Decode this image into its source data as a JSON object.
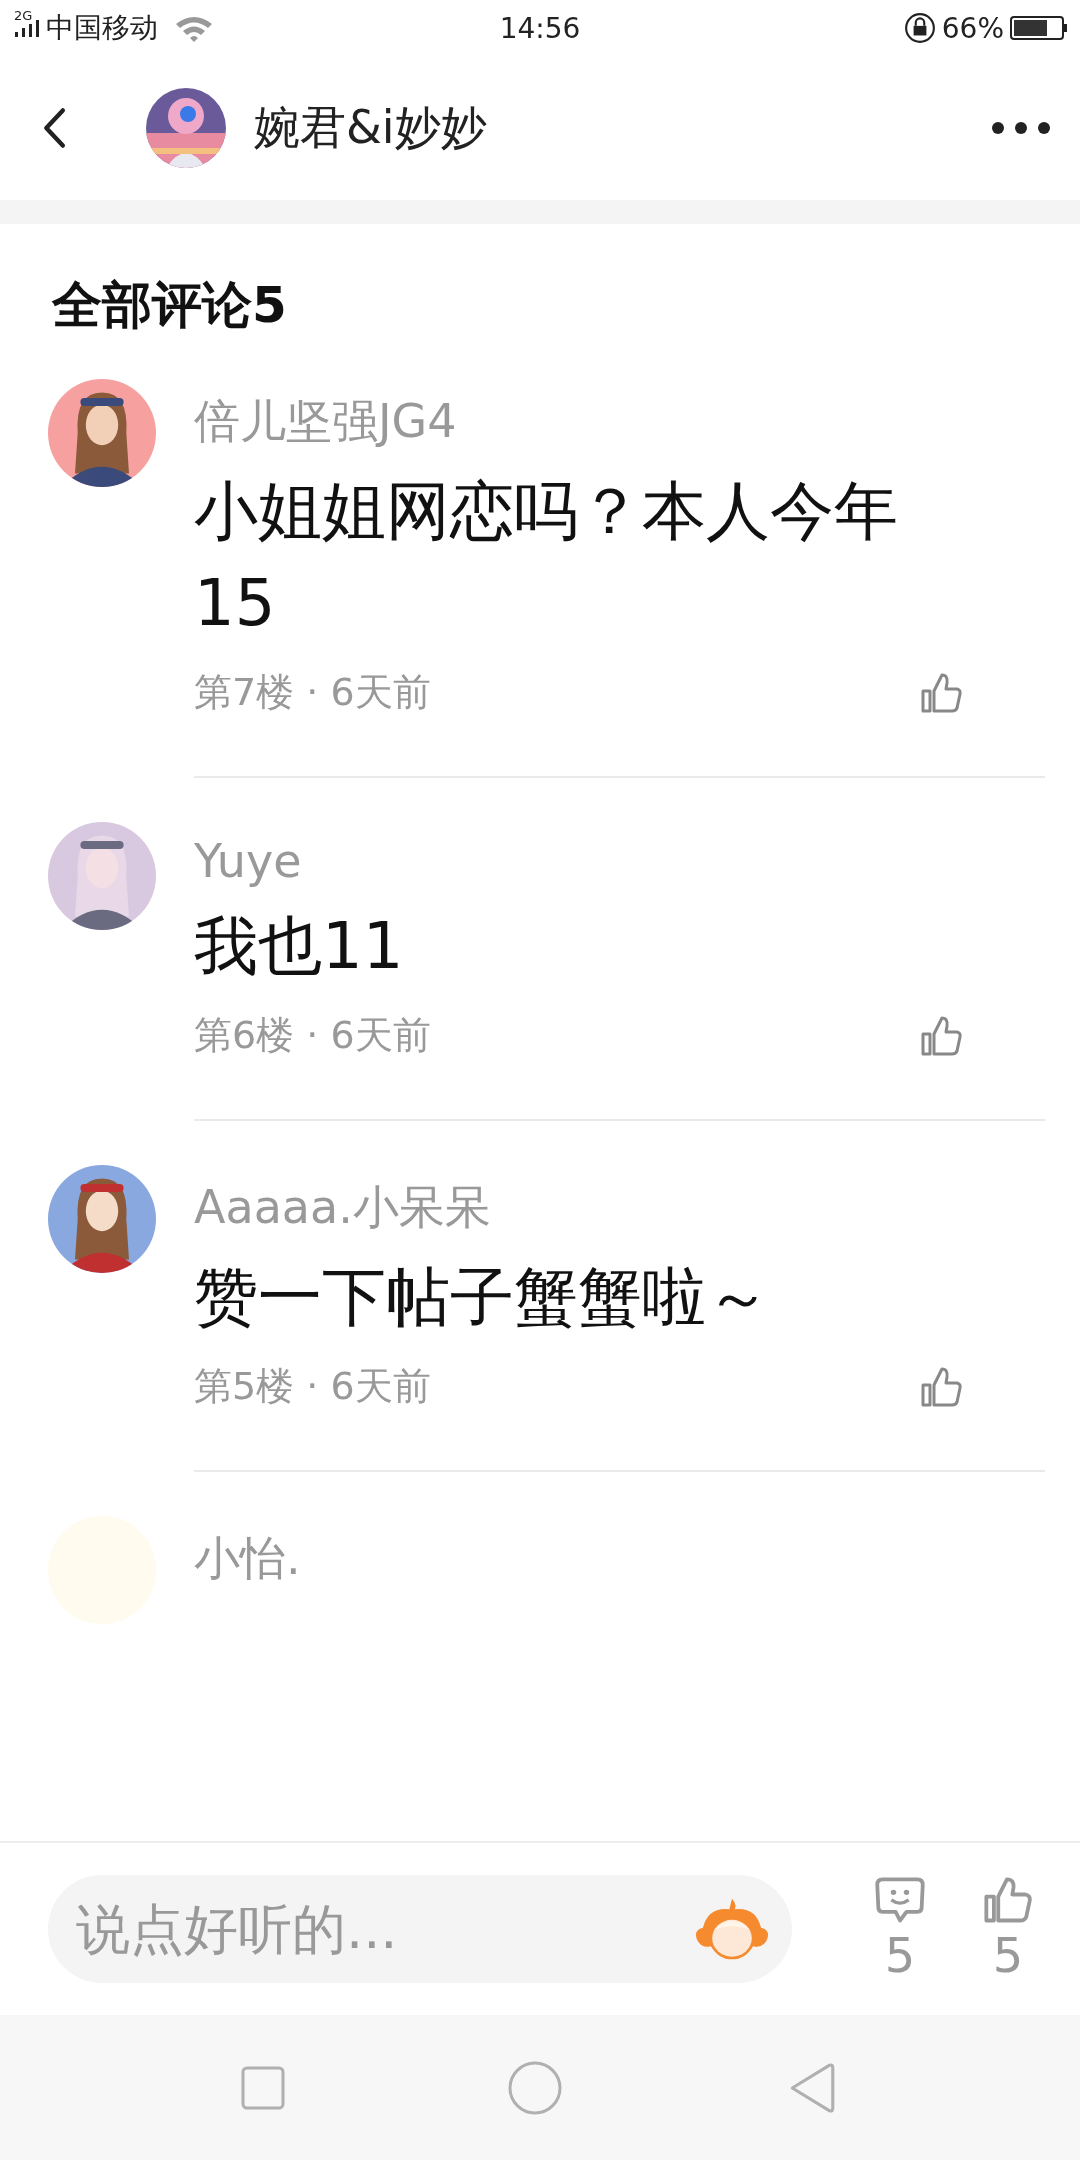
{
  "status_bar": {
    "network": "2G",
    "carrier": "中国移动",
    "time": "14:56",
    "battery": "66%"
  },
  "header": {
    "title": "婉君&i妙妙"
  },
  "comments_title": "全部评论5",
  "comments": [
    {
      "author": "倍儿坚强JG4",
      "text": "小姐姐网恋吗？本人今年15",
      "meta": "第7楼 · 6天前"
    },
    {
      "author": "Yuye",
      "text": "我也11",
      "meta": "第6楼 · 6天前"
    },
    {
      "author": "Aaaaa.小呆呆",
      "text": "赞一下帖子蟹蟹啦～",
      "meta": "第5楼 · 6天前"
    },
    {
      "author": "小怡.",
      "avatar": {
        "kind": "plain"
      }
    }
  ],
  "bottom_bar": {
    "placeholder": "说点好听的...",
    "comment_count": "5",
    "like_count": "5"
  }
}
